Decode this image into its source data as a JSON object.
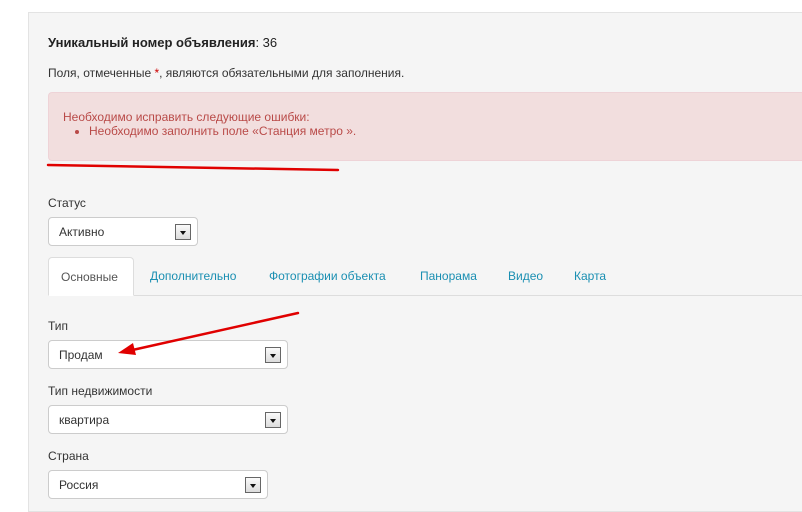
{
  "listing": {
    "id_label": "Уникальный номер объявления",
    "id_value": "36"
  },
  "required_note": {
    "before": "Поля, отмеченные ",
    "star": "*",
    "after": ", являются обязательными для заполнения."
  },
  "error_alert": {
    "heading": "Необходимо исправить следующие ошибки:",
    "items": [
      "Необходимо заполнить поле «Станция метро »."
    ]
  },
  "status": {
    "label": "Статус",
    "value": "Активно"
  },
  "tabs": [
    {
      "label": "Основные",
      "active": true
    },
    {
      "label": "Дополнительно"
    },
    {
      "label": "Фотографии объекта"
    },
    {
      "label": "Панорама"
    },
    {
      "label": "Видео"
    },
    {
      "label": "Карта"
    }
  ],
  "fields": {
    "type": {
      "label": "Тип",
      "value": "Продам"
    },
    "property_type": {
      "label": "Тип недвижимости",
      "value": "квартира"
    },
    "country": {
      "label": "Страна",
      "value": "Россия"
    }
  },
  "colors": {
    "error_text": "#b94a48",
    "error_bg": "#f2dede",
    "tab_link": "#1a8fb2",
    "annotation": "#e00000"
  }
}
